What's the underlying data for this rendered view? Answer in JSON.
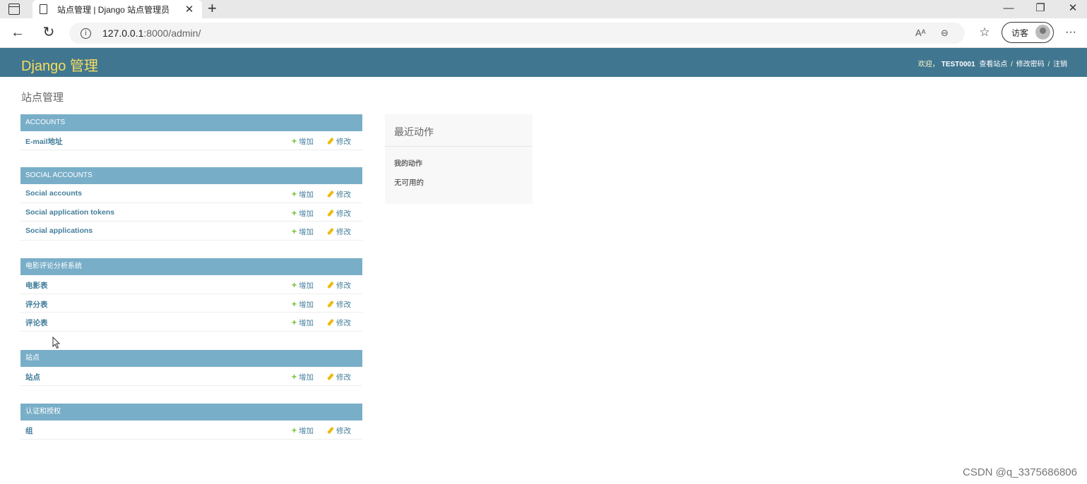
{
  "browser": {
    "tab_title": "站点管理 | Django 站点管理员",
    "tab_close": "✕",
    "new_tab": "+",
    "back": "←",
    "reload": "↻",
    "url_host": "127.0.0.1",
    "url_path": ":8000/admin/",
    "guest_label": "访客",
    "more": "···",
    "minimize": "—",
    "restore": "❐",
    "close": "✕"
  },
  "header": {
    "brand": "Django 管理",
    "welcome": "欢迎，",
    "username": "TEST0001",
    "view_site": "查看站点",
    "change_password": "修改密码",
    "logout": "注销",
    "sep": "/"
  },
  "page_title": "站点管理",
  "labels": {
    "add": "增加",
    "change": "修改"
  },
  "modules": [
    {
      "caption": "ACCOUNTS",
      "rows": [
        "E-mail地址"
      ]
    },
    {
      "caption": "SOCIAL ACCOUNTS",
      "rows": [
        "Social accounts",
        "Social application tokens",
        "Social applications"
      ]
    },
    {
      "caption": "电影评论分析系统",
      "rows": [
        "电影表",
        "评分表",
        "评论表"
      ]
    },
    {
      "caption": "站点",
      "rows": [
        "站点"
      ]
    },
    {
      "caption": "认证和授权",
      "rows": [
        "组"
      ]
    }
  ],
  "recent_actions": {
    "title": "最近动作",
    "subtitle": "我的动作",
    "empty": "无可用的"
  },
  "watermark": "CSDN @q_3375686806"
}
